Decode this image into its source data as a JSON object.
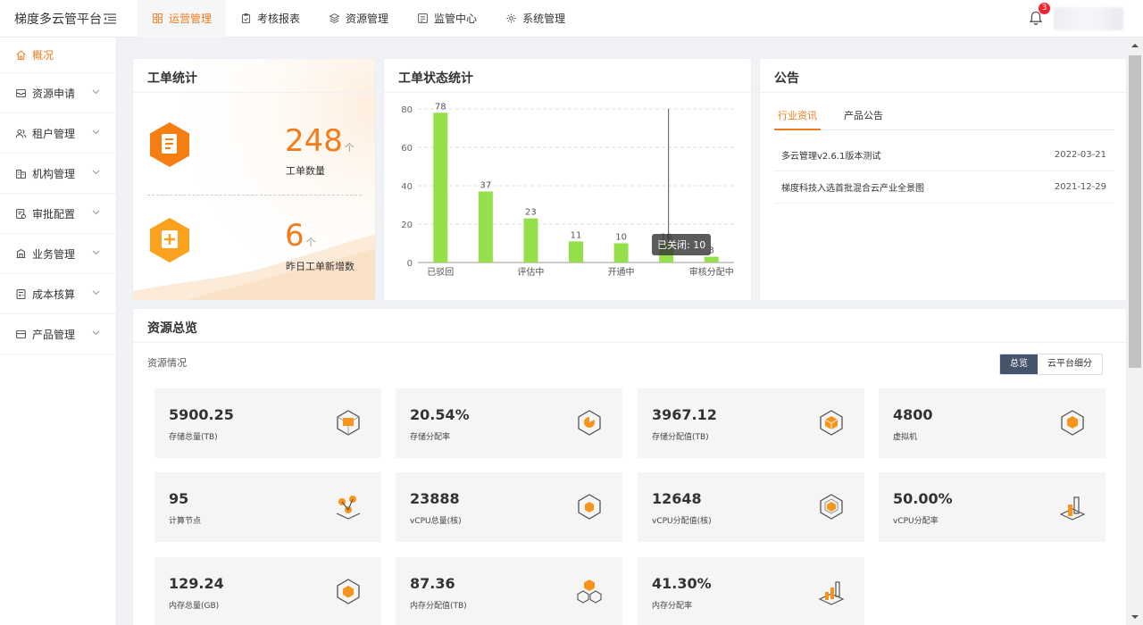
{
  "app": {
    "title": "梯度多云管平台"
  },
  "notifications": {
    "count": "3"
  },
  "topnav": [
    {
      "label": "运营管理",
      "icon": "ops-icon",
      "active": true
    },
    {
      "label": "考核报表",
      "icon": "clipboard-icon",
      "active": false
    },
    {
      "label": "资源管理",
      "icon": "layers-icon",
      "active": false
    },
    {
      "label": "监管中心",
      "icon": "monitor-icon",
      "active": false
    },
    {
      "label": "系统管理",
      "icon": "gear-icon",
      "active": false
    }
  ],
  "sidebar": [
    {
      "label": "概况",
      "icon": "home-icon",
      "active": true,
      "expandable": false
    },
    {
      "label": "资源申请",
      "icon": "inbox-icon",
      "active": false,
      "expandable": true
    },
    {
      "label": "租户管理",
      "icon": "users-icon",
      "active": false,
      "expandable": true
    },
    {
      "label": "机构管理",
      "icon": "building-icon",
      "active": false,
      "expandable": true
    },
    {
      "label": "审批配置",
      "icon": "approval-icon",
      "active": false,
      "expandable": true
    },
    {
      "label": "业务管理",
      "icon": "business-icon",
      "active": false,
      "expandable": true
    },
    {
      "label": "成本核算",
      "icon": "calculator-icon",
      "active": false,
      "expandable": true
    },
    {
      "label": "产品管理",
      "icon": "product-icon",
      "active": false,
      "expandable": true
    }
  ],
  "workorder": {
    "title": "工单统计",
    "total": {
      "value": "248",
      "unit": "个",
      "label": "工单数量"
    },
    "new": {
      "value": "6",
      "unit": "个",
      "label": "昨日工单新增数"
    }
  },
  "status_chart": {
    "title": "工单状态统计",
    "tooltip": "已关闭: 10"
  },
  "chart_data": {
    "type": "bar",
    "categories": [
      "已驳回",
      "",
      "评估中",
      "",
      "开通中",
      "",
      "审核分配中"
    ],
    "values": [
      78,
      37,
      23,
      11,
      10,
      10,
      3
    ],
    "yticks": [
      0,
      20,
      40,
      60,
      80
    ],
    "ylim": [
      0,
      80
    ],
    "color": "#95e04a",
    "grid": true
  },
  "notice": {
    "title": "公告",
    "tabs": [
      {
        "label": "行业资讯",
        "active": true
      },
      {
        "label": "产品公告",
        "active": false
      }
    ],
    "items": [
      {
        "title": "多云管理v2.6.1版本测试",
        "date": "2022-03-21"
      },
      {
        "title": "梯度科技入选首批混合云产业全景图",
        "date": "2021-12-29"
      }
    ]
  },
  "resources": {
    "title": "资源总览",
    "subtitle": "资源情况",
    "toggle": [
      {
        "label": "总览",
        "active": true
      },
      {
        "label": "云平台细分",
        "active": false
      }
    ],
    "tiles": [
      {
        "value": "5900.25",
        "label": "存储总量(TB)",
        "icon": "storage-icon"
      },
      {
        "value": "20.54%",
        "label": "存储分配率",
        "icon": "pie-cube-icon"
      },
      {
        "value": "3967.12",
        "label": "存储分配值(TB)",
        "icon": "cube-icon"
      },
      {
        "value": "4800",
        "label": "虚拟机",
        "icon": "vm-icon"
      },
      {
        "value": "95",
        "label": "计算节点",
        "icon": "nodes-icon"
      },
      {
        "value": "23888",
        "label": "vCPU总量(核)",
        "icon": "cpu-icon"
      },
      {
        "value": "12648",
        "label": "vCPU分配值(核)",
        "icon": "cpu-alloc-icon"
      },
      {
        "value": "50.00%",
        "label": "vCPU分配率",
        "icon": "bar-cube-icon"
      },
      {
        "value": "129.24",
        "label": "内存总量(GB)",
        "icon": "memory-icon"
      },
      {
        "value": "87.36",
        "label": "内存分配值(TB)",
        "icon": "memory-alloc-icon"
      },
      {
        "value": "41.30%",
        "label": "内存分配率",
        "icon": "memory-rate-icon"
      }
    ]
  }
}
